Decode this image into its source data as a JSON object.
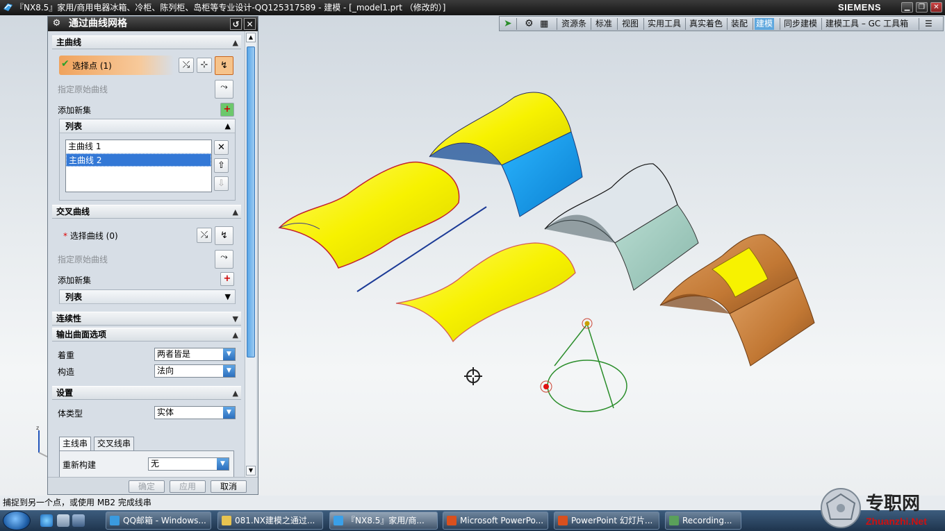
{
  "window": {
    "title": "『NX8.5』家用/商用电器冰箱、冷柜、陈列柜、岛柜等专业设计-QQ125317589 - 建模 - [_model1.prt （修改的）]",
    "brand": "SIEMENS"
  },
  "toolbar": {
    "items": [
      "资源条",
      "标准",
      "视图",
      "实用工具",
      "真实着色",
      "装配",
      "建模",
      "同步建模",
      "建模工具 – GC 工具箱"
    ],
    "active_item": "建模"
  },
  "dialog": {
    "title": "通过曲线网格",
    "primary": {
      "section_title": "主曲线",
      "select_label": "选择点 (1)",
      "specify_original": "指定原始曲线",
      "add_new_set": "添加新集",
      "list_title": "列表",
      "list_items": [
        "主曲线 1",
        "主曲线 2"
      ],
      "selected_item": "主曲线 2"
    },
    "cross": {
      "section_title": "交叉曲线",
      "select_label": "选择曲线 (0)",
      "specify_original": "指定原始曲线",
      "add_new_set": "添加新集",
      "list_title": "列表"
    },
    "continuity": {
      "section_title": "连续性"
    },
    "output": {
      "section_title": "输出曲面选项",
      "emphasis_label": "着重",
      "emphasis_value": "两者皆是",
      "construction_label": "构造",
      "construction_value": "法向"
    },
    "settings": {
      "section_title": "设置",
      "body_type_label": "体类型",
      "body_type_value": "实体",
      "tabs": [
        "主线串",
        "交叉线串"
      ],
      "active_tab": "主线串",
      "rebuild_label": "重新构建",
      "rebuild_value": "无"
    },
    "buttons": {
      "ok": "确定",
      "apply": "应用",
      "cancel": "取消"
    }
  },
  "status": {
    "prompt": "捕捉到另一个点，或使用 MB2 完成线串"
  },
  "taskbar": {
    "items": [
      "QQ邮箱 - Windows...",
      "081.NX建模之通过...",
      "『NX8.5』家用/商...",
      "Microsoft PowerPo...",
      "PowerPoint 幻灯片...",
      "Recording..."
    ],
    "active_item": "『NX8.5』家用/商..."
  },
  "watermark": {
    "name": "专职网",
    "url": "Zhuanzhi.Net"
  },
  "colors": {
    "surface_yellow": "#f7f200",
    "surface_blue": "#1aa3f0",
    "surface_teal": "#a7cfc3",
    "surface_copper": "#c97f3c",
    "selection_orange": "#f0a35d",
    "tab_active": "#5ea7de"
  }
}
